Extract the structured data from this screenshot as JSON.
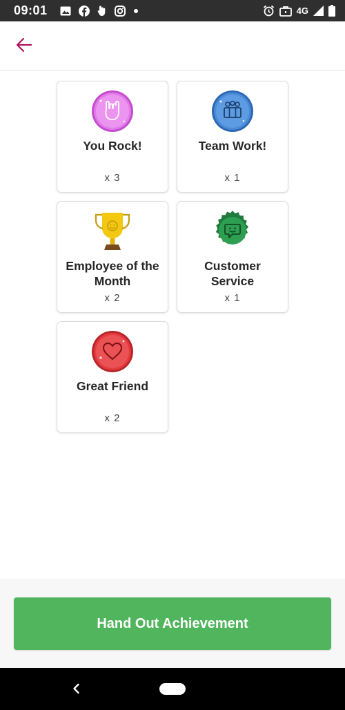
{
  "status_bar": {
    "time": "09:01",
    "network": "4G",
    "left_icons": [
      "image-icon",
      "facebook-icon",
      "touch-icon",
      "instagram-icon",
      "dot-icon"
    ],
    "right_icons": [
      "alarm-icon",
      "briefcase-icon",
      "signal-icon",
      "battery-icon"
    ]
  },
  "header": {
    "back_icon": "arrow-left-icon",
    "accent_color": "#b0125d"
  },
  "badges": [
    {
      "name": "You Rock!",
      "count": "x 3",
      "icon": "rock-hand-icon",
      "color": "#e27ae8"
    },
    {
      "name": "Team Work!",
      "count": "x 1",
      "icon": "team-icon",
      "color": "#4a8ad6"
    },
    {
      "name": "Employee of the Month",
      "count": "x 2",
      "icon": "trophy-icon",
      "color": "#f2c811"
    },
    {
      "name": "Customer Service",
      "count": "x 1",
      "icon": "chat-smile-icon",
      "color": "#2e9e52"
    },
    {
      "name": "Great Friend",
      "count": "x 2",
      "icon": "heart-icon",
      "color": "#e23a3e"
    }
  ],
  "footer": {
    "button_label": "Hand Out Achievement",
    "button_color": "#51b55d"
  },
  "nav_bar": {
    "back_icon": "nav-back-icon",
    "home_icon": "nav-home-icon"
  }
}
